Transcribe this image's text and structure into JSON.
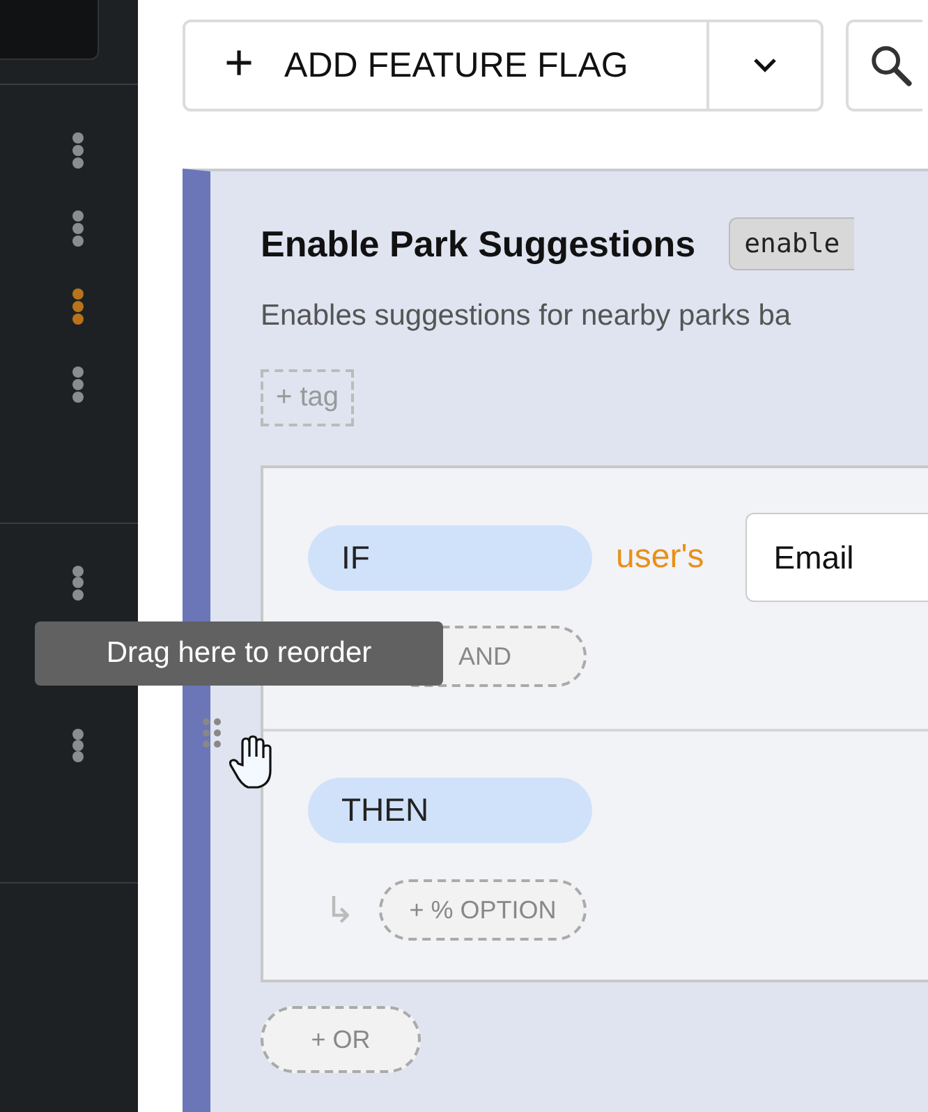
{
  "sidebar": {
    "groups": [
      {
        "menus": [
          {
            "active": false
          },
          {
            "active": false
          },
          {
            "active": true
          },
          {
            "active": false
          }
        ]
      },
      {
        "menus": [
          {
            "active": false
          },
          {
            "active": false
          }
        ]
      }
    ]
  },
  "toolbar": {
    "add_button": {
      "label": "ADD FEATURE FLAG",
      "icon": "+"
    }
  },
  "flag": {
    "title": "Enable Park Suggestions",
    "key": "enable",
    "description": "Enables suggestions for nearby parks ba",
    "add_tag": "+ tag",
    "conditions": {
      "if_label": "IF",
      "subject": "user's",
      "attribute": "Email",
      "add_and": "AND"
    },
    "outcome": {
      "then_label": "THEN",
      "arrow": "↳",
      "add_option": "+ % OPTION"
    },
    "add_or": "+ OR"
  },
  "tooltip": "Drag here to reorder"
}
